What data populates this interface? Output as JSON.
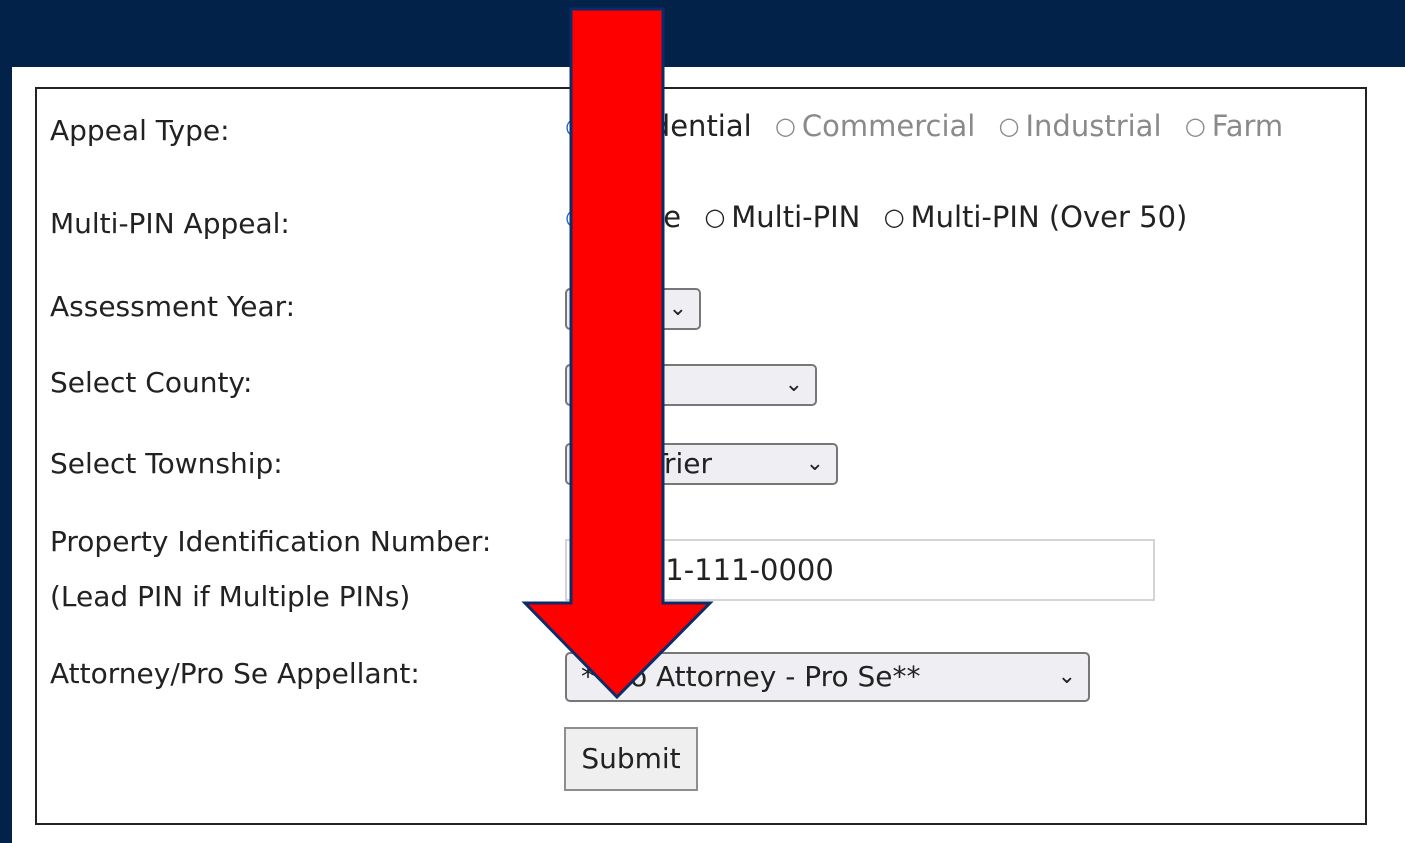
{
  "form": {
    "appeal_type": {
      "label": "Appeal Type:",
      "options": [
        {
          "text": "Residential",
          "state": "selected"
        },
        {
          "text": "Commercial",
          "state": "disabled"
        },
        {
          "text": "Industrial",
          "state": "disabled"
        },
        {
          "text": "Farm",
          "state": "disabled"
        }
      ]
    },
    "multi_pin": {
      "label": "Multi-PIN Appeal:",
      "options": [
        {
          "text": "Single",
          "state": "selected"
        },
        {
          "text": "Multi-PIN",
          "state": "enabled"
        },
        {
          "text": "Multi-PIN (Over 50)",
          "state": "enabled"
        }
      ]
    },
    "assessment_year": {
      "label": "Assessment Year:",
      "selected": ""
    },
    "county": {
      "label": "Select County:",
      "selected": ""
    },
    "township": {
      "label": "Select Township:",
      "selected": "New Trier"
    },
    "pin": {
      "label_line1": "Property Identification Number:",
      "label_line2": "(Lead PIN if Multiple PINs)",
      "value": "11-111-111-0000"
    },
    "attorney": {
      "label": "Attorney/Pro Se Appellant:",
      "selected": "**No Attorney - Pro Se**"
    },
    "submit_label": "Submit"
  },
  "overlay": {
    "arrow_color": "#ff0000",
    "arrow_outline": "#0b2c69",
    "header_color": "#03224a"
  }
}
